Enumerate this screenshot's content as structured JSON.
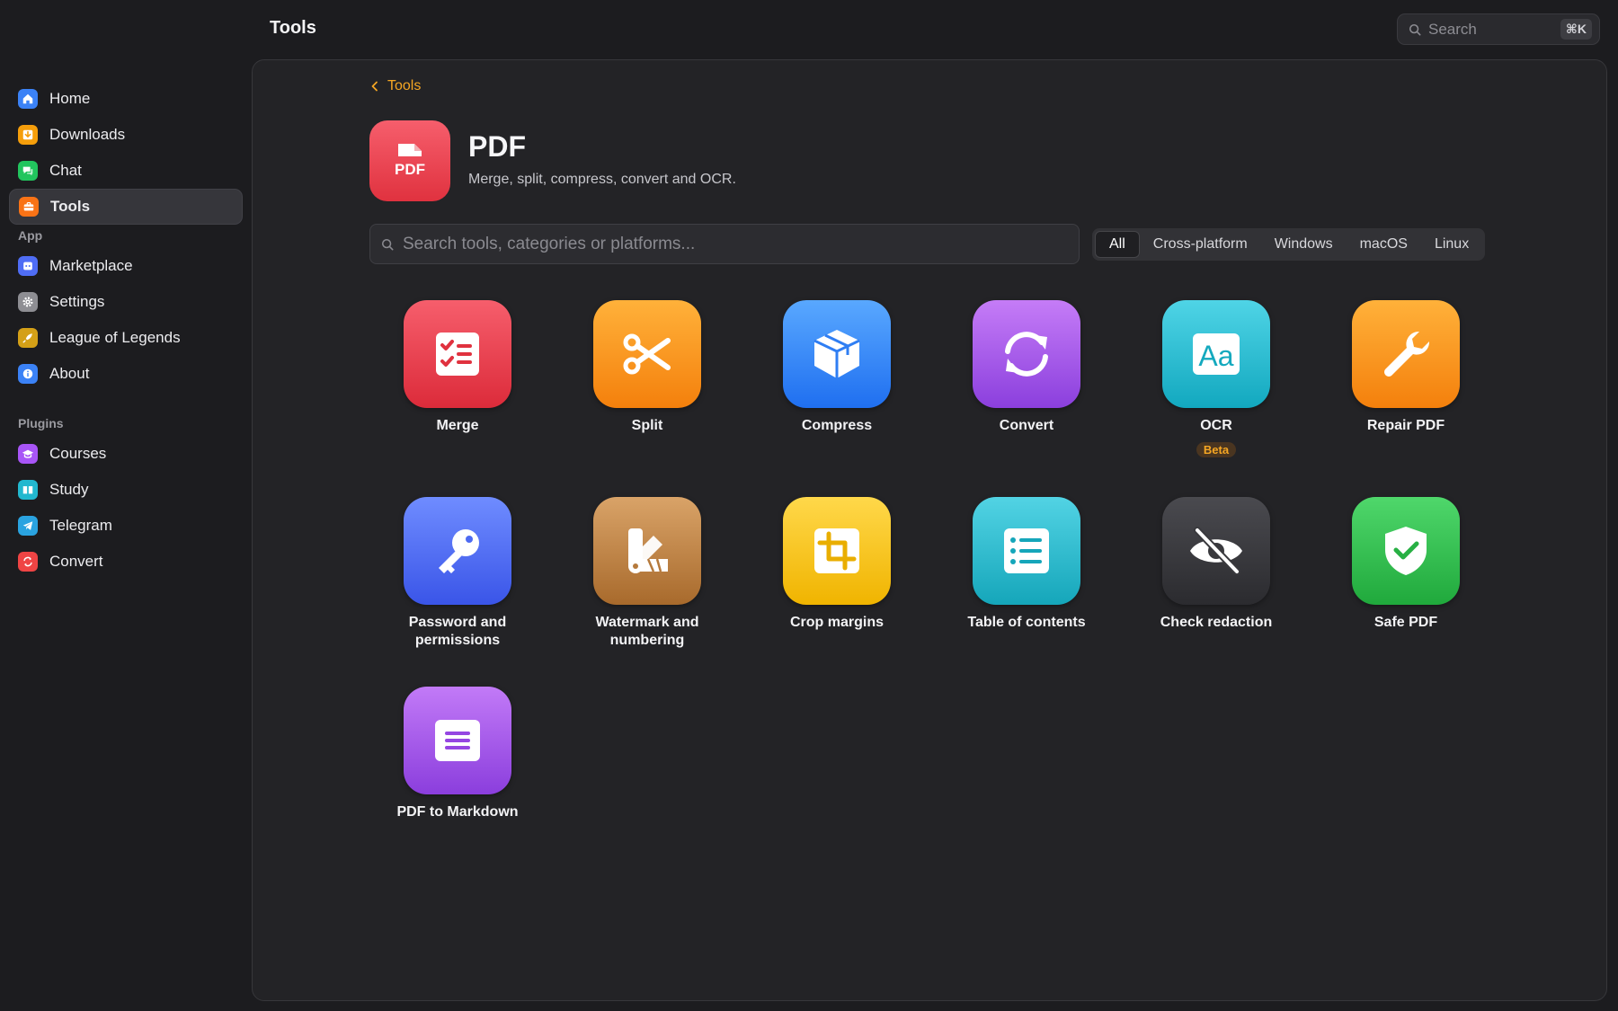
{
  "app": {
    "title": "Tools"
  },
  "top_search": {
    "placeholder": "Search",
    "shortcut": "⌘K"
  },
  "sidebar": {
    "main_items": [
      {
        "label": "Home",
        "icon": "home-icon",
        "color": "#3b82f6"
      },
      {
        "label": "Downloads",
        "icon": "download-icon",
        "color": "#f59e0b"
      },
      {
        "label": "Chat",
        "icon": "chat-icon",
        "color": "#22c55e"
      },
      {
        "label": "Tools",
        "icon": "toolbox-icon",
        "color": "#f97316",
        "active": true
      }
    ],
    "app_section": "App",
    "app_items": [
      {
        "label": "Marketplace",
        "icon": "store-icon",
        "color": "#4f6df5"
      },
      {
        "label": "Settings",
        "icon": "gear-icon",
        "color": "#8e8e93"
      },
      {
        "label": "League of Legends",
        "icon": "rocket-icon",
        "color": "#d4a017"
      },
      {
        "label": "About",
        "icon": "info-icon",
        "color": "#3b82f6"
      }
    ],
    "plugins_section": "Plugins",
    "plugin_items": [
      {
        "label": "Courses",
        "icon": "graduation-cap-icon",
        "color": "#a855f7"
      },
      {
        "label": "Study",
        "icon": "book-icon",
        "color": "#22b8cf"
      },
      {
        "label": "Telegram",
        "icon": "telegram-icon",
        "color": "#2aa3e0"
      },
      {
        "label": "Convert",
        "icon": "convert-icon",
        "color": "#ef4444"
      }
    ]
  },
  "main": {
    "breadcrumb": "Tools",
    "header": {
      "title": "PDF",
      "subtitle": "Merge, split, compress, convert and OCR.",
      "icon_text": "PDF"
    },
    "search": {
      "placeholder": "Search tools, categories or platforms..."
    },
    "filters": [
      "All",
      "Cross-platform",
      "Windows",
      "macOS",
      "Linux"
    ],
    "active_filter": "All",
    "tools": [
      {
        "label": "Merge",
        "icon": "checklist-icon",
        "colors": [
          "#f65e6c",
          "#dc2b3a"
        ]
      },
      {
        "label": "Split",
        "icon": "scissors-icon",
        "colors": [
          "#ffb13a",
          "#f4800c"
        ]
      },
      {
        "label": "Compress",
        "icon": "box-icon",
        "colors": [
          "#59a8ff",
          "#1f6ff0"
        ]
      },
      {
        "label": "Convert",
        "icon": "refresh-icon",
        "colors": [
          "#c57cf7",
          "#8b3fdd"
        ]
      },
      {
        "label": "OCR",
        "icon": "text-format-icon",
        "colors": [
          "#4fd4e6",
          "#12a8bf"
        ],
        "badge": "Beta"
      },
      {
        "label": "Repair PDF",
        "icon": "wrench-icon",
        "colors": [
          "#ffb13a",
          "#f4800c"
        ]
      },
      {
        "label": "Password and\npermissions",
        "icon": "key-icon",
        "colors": [
          "#6f8cff",
          "#3a55e8"
        ]
      },
      {
        "label": "Watermark and\nnumbering",
        "icon": "swatch-icon",
        "colors": [
          "#d9a368",
          "#a86a2c"
        ]
      },
      {
        "label": "Crop margins",
        "icon": "crop-icon",
        "colors": [
          "#ffd84a",
          "#f0b400"
        ]
      },
      {
        "label": "Table of contents",
        "icon": "list-icon",
        "colors": [
          "#52d3e4",
          "#15a6ba"
        ]
      },
      {
        "label": "Check redaction",
        "icon": "eye-slash-icon",
        "colors": [
          "#4a4a4f",
          "#2b2b2f"
        ]
      },
      {
        "label": "Safe PDF",
        "icon": "shield-check-icon",
        "colors": [
          "#4fd76b",
          "#20a93c"
        ]
      },
      {
        "label": "PDF to Markdown",
        "icon": "document-lines-icon",
        "colors": [
          "#c27af7",
          "#8b3edd"
        ]
      }
    ]
  }
}
